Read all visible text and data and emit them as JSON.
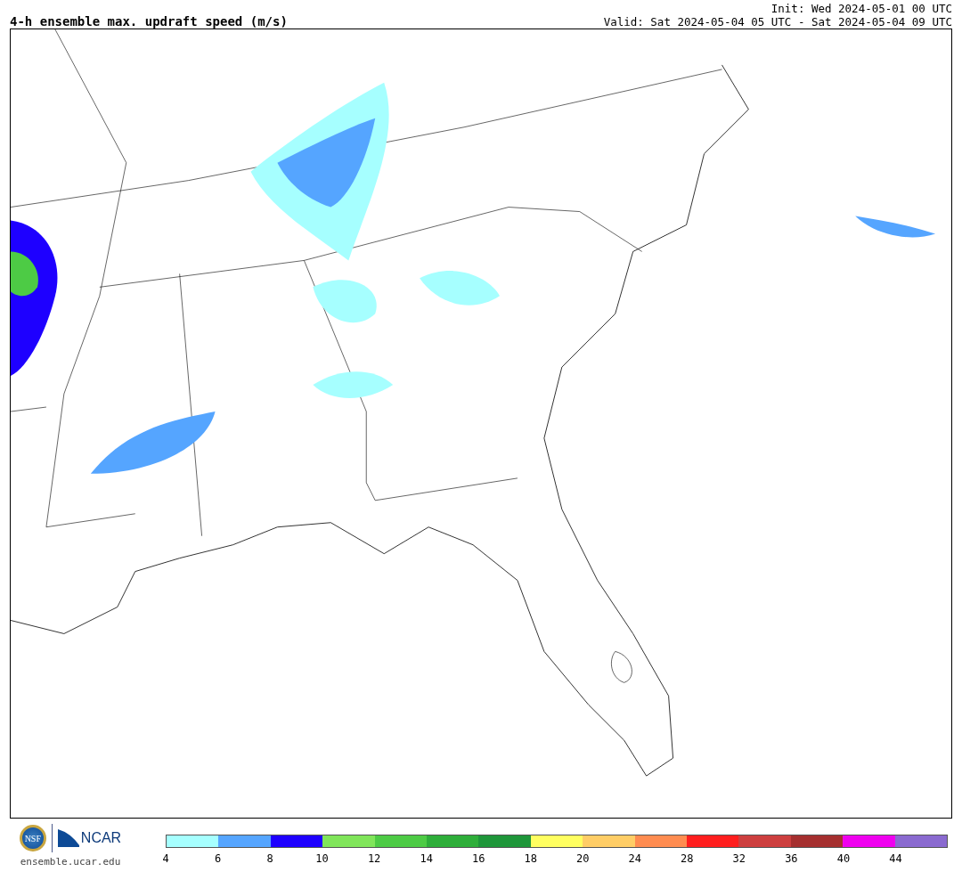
{
  "title": "4-h ensemble max. updraft speed (m/s)",
  "init": "Init: Wed 2024-05-01 00 UTC",
  "valid": "Valid: Sat 2024-05-04 05 UTC - Sat 2024-05-04 09 UTC",
  "logos": {
    "nsf": "NSF",
    "ncar": "NCAR",
    "url": "ensemble.ucar.edu"
  },
  "colorbar": [
    {
      "color": "#a6ffff",
      "label": "4"
    },
    {
      "color": "#55a5ff",
      "label": "6"
    },
    {
      "color": "#1e00ff",
      "label": "8"
    },
    {
      "color": "#80e55a",
      "label": "10"
    },
    {
      "color": "#4dcb45",
      "label": "12"
    },
    {
      "color": "#2eae3a",
      "label": "14"
    },
    {
      "color": "#1e963a",
      "label": "16"
    },
    {
      "color": "#ffff60",
      "label": "18"
    },
    {
      "color": "#ffcd66",
      "label": "20"
    },
    {
      "color": "#ff8c50",
      "label": "24"
    },
    {
      "color": "#ff1e1e",
      "label": "28"
    },
    {
      "color": "#cd3f3f",
      "label": "32"
    },
    {
      "color": "#a52f2f",
      "label": "36"
    },
    {
      "color": "#ef00ef",
      "label": "40"
    },
    {
      "color": "#8a6ad0",
      "label": "44"
    }
  ]
}
